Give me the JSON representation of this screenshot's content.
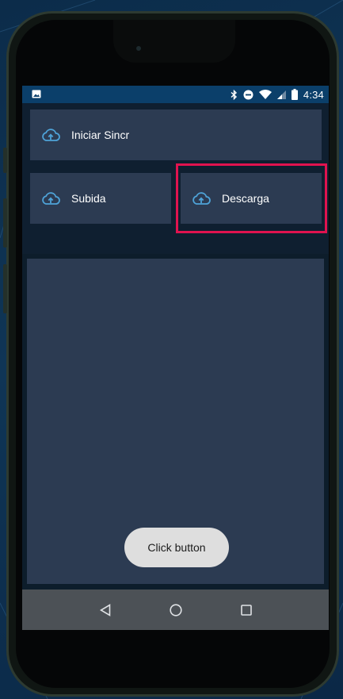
{
  "status_bar": {
    "time": "4:34",
    "icons": [
      "gallery-icon",
      "bluetooth-icon",
      "do-not-disturb-icon",
      "wifi-icon",
      "signal-icon",
      "battery-icon"
    ]
  },
  "buttons": {
    "sync_label": "Iniciar Sincr",
    "upload_label": "Subida",
    "download_label": "Descarga",
    "icon": "cloud-upload-icon"
  },
  "toast": {
    "text": "Click button"
  },
  "nav_bar": {
    "icons": [
      "back-icon",
      "home-icon",
      "recents-icon"
    ]
  },
  "colors": {
    "status_bar": "#0b3f6a",
    "button_bg": "#2c3b52",
    "highlight": "#e0134f",
    "icon_accent": "#4ea3d8",
    "nav_bar": "#4c5156"
  }
}
